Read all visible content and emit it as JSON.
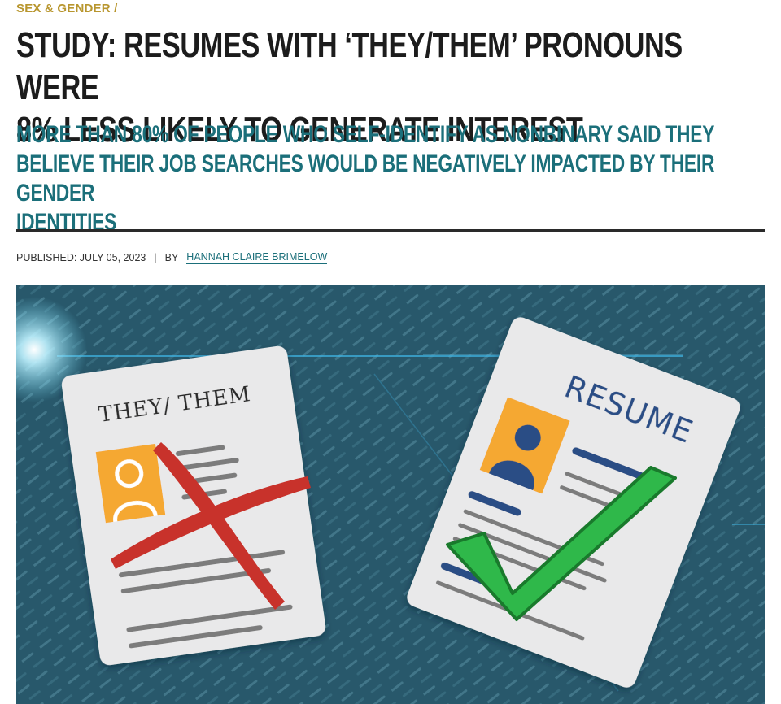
{
  "article": {
    "category": "SEX & GENDER /",
    "headline_line1": "STUDY: RESUMES WITH ‘THEY/THEM’ PRONOUNS WERE",
    "headline_line2": "8% LESS LIKELY TO GENERATE INTEREST",
    "subhead_line1": "MORE THAN 80% OF PEOPLE WHO SELF-IDENTIFY AS NONBINARY SAID THEY",
    "subhead_line2": "BELIEVE THEIR JOB SEARCHES WOULD BE NEGATIVELY IMPACTED BY THEIR GENDER",
    "subhead_line3": "IDENTITIES",
    "published_label": "PUBLISHED: JULY 05, 2023",
    "separator": "|",
    "by_label": "BY",
    "author": "HANNAH CLAIRE BRIMELOW"
  },
  "hero_image": {
    "left_doc_text": "THEY/ THEM",
    "right_doc_text": "RESUME",
    "background_color": "#2c5d70",
    "photo_color": "#f5a832",
    "cross_color": "#c8322b",
    "check_color": "#2fb84a",
    "icons": [
      "x-mark-icon",
      "checkmark-icon",
      "person-icon"
    ]
  }
}
